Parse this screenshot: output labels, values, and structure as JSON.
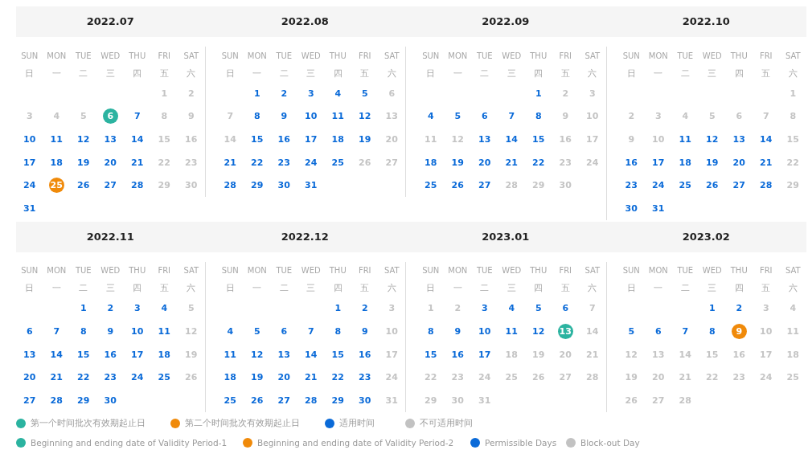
{
  "months": [
    {
      "title": "2022.07",
      "weekdays_en": [
        "SUN",
        "MON",
        "TUE",
        "WED",
        "THU",
        "FRI",
        "SAT"
      ],
      "weekdays_zh": [
        "日",
        "一",
        "二",
        "三",
        "四",
        "五",
        "六"
      ],
      "days": [
        {
          "kind": "blank"
        },
        {
          "kind": "blank"
        },
        {
          "kind": "blank"
        },
        {
          "kind": "blank"
        },
        {
          "kind": "blank"
        },
        {
          "d": "1",
          "kind": "off"
        },
        {
          "d": "2",
          "kind": "off"
        },
        {
          "d": "3",
          "kind": "off"
        },
        {
          "d": "4",
          "kind": "off"
        },
        {
          "d": "5",
          "kind": "off"
        },
        {
          "d": "6",
          "kind": "period1"
        },
        {
          "d": "7",
          "kind": "on"
        },
        {
          "d": "8",
          "kind": "off"
        },
        {
          "d": "9",
          "kind": "off"
        },
        {
          "d": "10",
          "kind": "on"
        },
        {
          "d": "11",
          "kind": "on"
        },
        {
          "d": "12",
          "kind": "on"
        },
        {
          "d": "13",
          "kind": "on"
        },
        {
          "d": "14",
          "kind": "on"
        },
        {
          "d": "15",
          "kind": "off"
        },
        {
          "d": "16",
          "kind": "off"
        },
        {
          "d": "17",
          "kind": "on"
        },
        {
          "d": "18",
          "kind": "on"
        },
        {
          "d": "19",
          "kind": "on"
        },
        {
          "d": "20",
          "kind": "on"
        },
        {
          "d": "21",
          "kind": "on"
        },
        {
          "d": "22",
          "kind": "off"
        },
        {
          "d": "23",
          "kind": "off"
        },
        {
          "d": "24",
          "kind": "on"
        },
        {
          "d": "25",
          "kind": "period2"
        },
        {
          "d": "26",
          "kind": "on"
        },
        {
          "d": "27",
          "kind": "on"
        },
        {
          "d": "28",
          "kind": "on"
        },
        {
          "d": "29",
          "kind": "off"
        },
        {
          "d": "30",
          "kind": "off"
        },
        {
          "d": "31",
          "kind": "on"
        }
      ]
    },
    {
      "title": "2022.08",
      "weekdays_en": [
        "SUN",
        "MON",
        "TUE",
        "WED",
        "THU",
        "FRI",
        "SAT"
      ],
      "weekdays_zh": [
        "日",
        "一",
        "二",
        "三",
        "四",
        "五",
        "六"
      ],
      "days": [
        {
          "kind": "blank"
        },
        {
          "d": "1",
          "kind": "on"
        },
        {
          "d": "2",
          "kind": "on"
        },
        {
          "d": "3",
          "kind": "on"
        },
        {
          "d": "4",
          "kind": "on"
        },
        {
          "d": "5",
          "kind": "on"
        },
        {
          "d": "6",
          "kind": "off"
        },
        {
          "d": "7",
          "kind": "off"
        },
        {
          "d": "8",
          "kind": "on"
        },
        {
          "d": "9",
          "kind": "on"
        },
        {
          "d": "10",
          "kind": "on"
        },
        {
          "d": "11",
          "kind": "on"
        },
        {
          "d": "12",
          "kind": "on"
        },
        {
          "d": "13",
          "kind": "off"
        },
        {
          "d": "14",
          "kind": "off"
        },
        {
          "d": "15",
          "kind": "on"
        },
        {
          "d": "16",
          "kind": "on"
        },
        {
          "d": "17",
          "kind": "on"
        },
        {
          "d": "18",
          "kind": "on"
        },
        {
          "d": "19",
          "kind": "on"
        },
        {
          "d": "20",
          "kind": "off"
        },
        {
          "d": "21",
          "kind": "on"
        },
        {
          "d": "22",
          "kind": "on"
        },
        {
          "d": "23",
          "kind": "on"
        },
        {
          "d": "24",
          "kind": "on"
        },
        {
          "d": "25",
          "kind": "on"
        },
        {
          "d": "26",
          "kind": "off"
        },
        {
          "d": "27",
          "kind": "off"
        },
        {
          "d": "28",
          "kind": "on"
        },
        {
          "d": "29",
          "kind": "on"
        },
        {
          "d": "30",
          "kind": "on"
        },
        {
          "d": "31",
          "kind": "on"
        }
      ]
    },
    {
      "title": "2022.09",
      "weekdays_en": [
        "SUN",
        "MON",
        "TUE",
        "WED",
        "THU",
        "FRI",
        "SAT"
      ],
      "weekdays_zh": [
        "日",
        "一",
        "二",
        "三",
        "四",
        "五",
        "六"
      ],
      "days": [
        {
          "kind": "blank"
        },
        {
          "kind": "blank"
        },
        {
          "kind": "blank"
        },
        {
          "kind": "blank"
        },
        {
          "d": "1",
          "kind": "on"
        },
        {
          "d": "2",
          "kind": "off"
        },
        {
          "d": "3",
          "kind": "off"
        },
        {
          "d": "4",
          "kind": "on"
        },
        {
          "d": "5",
          "kind": "on"
        },
        {
          "d": "6",
          "kind": "on"
        },
        {
          "d": "7",
          "kind": "on"
        },
        {
          "d": "8",
          "kind": "on"
        },
        {
          "d": "9",
          "kind": "off"
        },
        {
          "d": "10",
          "kind": "off"
        },
        {
          "d": "11",
          "kind": "off"
        },
        {
          "d": "12",
          "kind": "off"
        },
        {
          "d": "13",
          "kind": "on"
        },
        {
          "d": "14",
          "kind": "on"
        },
        {
          "d": "15",
          "kind": "on"
        },
        {
          "d": "16",
          "kind": "off"
        },
        {
          "d": "17",
          "kind": "off"
        },
        {
          "d": "18",
          "kind": "on"
        },
        {
          "d": "19",
          "kind": "on"
        },
        {
          "d": "20",
          "kind": "on"
        },
        {
          "d": "21",
          "kind": "on"
        },
        {
          "d": "22",
          "kind": "on"
        },
        {
          "d": "23",
          "kind": "off"
        },
        {
          "d": "24",
          "kind": "off"
        },
        {
          "d": "25",
          "kind": "on"
        },
        {
          "d": "26",
          "kind": "on"
        },
        {
          "d": "27",
          "kind": "on"
        },
        {
          "d": "28",
          "kind": "off"
        },
        {
          "d": "29",
          "kind": "off"
        },
        {
          "d": "30",
          "kind": "off"
        }
      ]
    },
    {
      "title": "2022.10",
      "weekdays_en": [
        "SUN",
        "MON",
        "TUE",
        "WED",
        "THU",
        "FRI",
        "SAT"
      ],
      "weekdays_zh": [
        "日",
        "一",
        "二",
        "三",
        "四",
        "五",
        "六"
      ],
      "days": [
        {
          "kind": "blank"
        },
        {
          "kind": "blank"
        },
        {
          "kind": "blank"
        },
        {
          "kind": "blank"
        },
        {
          "kind": "blank"
        },
        {
          "kind": "blank"
        },
        {
          "d": "1",
          "kind": "off"
        },
        {
          "d": "2",
          "kind": "off"
        },
        {
          "d": "3",
          "kind": "off"
        },
        {
          "d": "4",
          "kind": "off"
        },
        {
          "d": "5",
          "kind": "off"
        },
        {
          "d": "6",
          "kind": "off"
        },
        {
          "d": "7",
          "kind": "off"
        },
        {
          "d": "8",
          "kind": "off"
        },
        {
          "d": "9",
          "kind": "off"
        },
        {
          "d": "10",
          "kind": "off"
        },
        {
          "d": "11",
          "kind": "on"
        },
        {
          "d": "12",
          "kind": "on"
        },
        {
          "d": "13",
          "kind": "on"
        },
        {
          "d": "14",
          "kind": "on"
        },
        {
          "d": "15",
          "kind": "off"
        },
        {
          "d": "16",
          "kind": "on"
        },
        {
          "d": "17",
          "kind": "on"
        },
        {
          "d": "18",
          "kind": "on"
        },
        {
          "d": "19",
          "kind": "on"
        },
        {
          "d": "20",
          "kind": "on"
        },
        {
          "d": "21",
          "kind": "on"
        },
        {
          "d": "22",
          "kind": "off"
        },
        {
          "d": "23",
          "kind": "on"
        },
        {
          "d": "24",
          "kind": "on"
        },
        {
          "d": "25",
          "kind": "on"
        },
        {
          "d": "26",
          "kind": "on"
        },
        {
          "d": "27",
          "kind": "on"
        },
        {
          "d": "28",
          "kind": "on"
        },
        {
          "d": "29",
          "kind": "off"
        },
        {
          "d": "30",
          "kind": "on"
        },
        {
          "d": "31",
          "kind": "on"
        }
      ]
    },
    {
      "title": "2022.11",
      "weekdays_en": [
        "SUN",
        "MON",
        "TUE",
        "WED",
        "THU",
        "FRI",
        "SAT"
      ],
      "weekdays_zh": [
        "日",
        "一",
        "二",
        "三",
        "四",
        "五",
        "六"
      ],
      "days": [
        {
          "kind": "blank"
        },
        {
          "kind": "blank"
        },
        {
          "d": "1",
          "kind": "on"
        },
        {
          "d": "2",
          "kind": "on"
        },
        {
          "d": "3",
          "kind": "on"
        },
        {
          "d": "4",
          "kind": "on"
        },
        {
          "d": "5",
          "kind": "off"
        },
        {
          "d": "6",
          "kind": "on"
        },
        {
          "d": "7",
          "kind": "on"
        },
        {
          "d": "8",
          "kind": "on"
        },
        {
          "d": "9",
          "kind": "on"
        },
        {
          "d": "10",
          "kind": "on"
        },
        {
          "d": "11",
          "kind": "on"
        },
        {
          "d": "12",
          "kind": "off"
        },
        {
          "d": "13",
          "kind": "on"
        },
        {
          "d": "14",
          "kind": "on"
        },
        {
          "d": "15",
          "kind": "on"
        },
        {
          "d": "16",
          "kind": "on"
        },
        {
          "d": "17",
          "kind": "on"
        },
        {
          "d": "18",
          "kind": "on"
        },
        {
          "d": "19",
          "kind": "off"
        },
        {
          "d": "20",
          "kind": "on"
        },
        {
          "d": "21",
          "kind": "on"
        },
        {
          "d": "22",
          "kind": "on"
        },
        {
          "d": "23",
          "kind": "on"
        },
        {
          "d": "24",
          "kind": "on"
        },
        {
          "d": "25",
          "kind": "on"
        },
        {
          "d": "26",
          "kind": "off"
        },
        {
          "d": "27",
          "kind": "on"
        },
        {
          "d": "28",
          "kind": "on"
        },
        {
          "d": "29",
          "kind": "on"
        },
        {
          "d": "30",
          "kind": "on"
        }
      ]
    },
    {
      "title": "2022.12",
      "weekdays_en": [
        "SUN",
        "MON",
        "TUE",
        "WED",
        "THU",
        "FRI",
        "SAT"
      ],
      "weekdays_zh": [
        "日",
        "一",
        "二",
        "三",
        "四",
        "五",
        "六"
      ],
      "days": [
        {
          "kind": "blank"
        },
        {
          "kind": "blank"
        },
        {
          "kind": "blank"
        },
        {
          "kind": "blank"
        },
        {
          "d": "1",
          "kind": "on"
        },
        {
          "d": "2",
          "kind": "on"
        },
        {
          "d": "3",
          "kind": "off"
        },
        {
          "d": "4",
          "kind": "on"
        },
        {
          "d": "5",
          "kind": "on"
        },
        {
          "d": "6",
          "kind": "on"
        },
        {
          "d": "7",
          "kind": "on"
        },
        {
          "d": "8",
          "kind": "on"
        },
        {
          "d": "9",
          "kind": "on"
        },
        {
          "d": "10",
          "kind": "off"
        },
        {
          "d": "11",
          "kind": "on"
        },
        {
          "d": "12",
          "kind": "on"
        },
        {
          "d": "13",
          "kind": "on"
        },
        {
          "d": "14",
          "kind": "on"
        },
        {
          "d": "15",
          "kind": "on"
        },
        {
          "d": "16",
          "kind": "on"
        },
        {
          "d": "17",
          "kind": "off"
        },
        {
          "d": "18",
          "kind": "on"
        },
        {
          "d": "19",
          "kind": "on"
        },
        {
          "d": "20",
          "kind": "on"
        },
        {
          "d": "21",
          "kind": "on"
        },
        {
          "d": "22",
          "kind": "on"
        },
        {
          "d": "23",
          "kind": "on"
        },
        {
          "d": "24",
          "kind": "off"
        },
        {
          "d": "25",
          "kind": "on"
        },
        {
          "d": "26",
          "kind": "on"
        },
        {
          "d": "27",
          "kind": "on"
        },
        {
          "d": "28",
          "kind": "on"
        },
        {
          "d": "29",
          "kind": "on"
        },
        {
          "d": "30",
          "kind": "on"
        },
        {
          "d": "31",
          "kind": "off"
        }
      ]
    },
    {
      "title": "2023.01",
      "weekdays_en": [
        "SUN",
        "MON",
        "TUE",
        "WED",
        "THU",
        "FRI",
        "SAT"
      ],
      "weekdays_zh": [
        "日",
        "一",
        "二",
        "三",
        "四",
        "五",
        "六"
      ],
      "days": [
        {
          "d": "1",
          "kind": "off"
        },
        {
          "d": "2",
          "kind": "off"
        },
        {
          "d": "3",
          "kind": "on"
        },
        {
          "d": "4",
          "kind": "on"
        },
        {
          "d": "5",
          "kind": "on"
        },
        {
          "d": "6",
          "kind": "on"
        },
        {
          "d": "7",
          "kind": "off"
        },
        {
          "d": "8",
          "kind": "on"
        },
        {
          "d": "9",
          "kind": "on"
        },
        {
          "d": "10",
          "kind": "on"
        },
        {
          "d": "11",
          "kind": "on"
        },
        {
          "d": "12",
          "kind": "on"
        },
        {
          "d": "13",
          "kind": "period1"
        },
        {
          "d": "14",
          "kind": "off"
        },
        {
          "d": "15",
          "kind": "on"
        },
        {
          "d": "16",
          "kind": "on"
        },
        {
          "d": "17",
          "kind": "on"
        },
        {
          "d": "18",
          "kind": "off"
        },
        {
          "d": "19",
          "kind": "off"
        },
        {
          "d": "20",
          "kind": "off"
        },
        {
          "d": "21",
          "kind": "off"
        },
        {
          "d": "22",
          "kind": "off"
        },
        {
          "d": "23",
          "kind": "off"
        },
        {
          "d": "24",
          "kind": "off"
        },
        {
          "d": "25",
          "kind": "off"
        },
        {
          "d": "26",
          "kind": "off"
        },
        {
          "d": "27",
          "kind": "off"
        },
        {
          "d": "28",
          "kind": "off"
        },
        {
          "d": "29",
          "kind": "off"
        },
        {
          "d": "30",
          "kind": "off"
        },
        {
          "d": "31",
          "kind": "off"
        }
      ]
    },
    {
      "title": "2023.02",
      "weekdays_en": [
        "SUN",
        "MON",
        "TUE",
        "WED",
        "THU",
        "FRI",
        "SAT"
      ],
      "weekdays_zh": [
        "日",
        "一",
        "二",
        "三",
        "四",
        "五",
        "六"
      ],
      "days": [
        {
          "kind": "blank"
        },
        {
          "kind": "blank"
        },
        {
          "kind": "blank"
        },
        {
          "d": "1",
          "kind": "on"
        },
        {
          "d": "2",
          "kind": "on"
        },
        {
          "d": "3",
          "kind": "off"
        },
        {
          "d": "4",
          "kind": "off"
        },
        {
          "d": "5",
          "kind": "on"
        },
        {
          "d": "6",
          "kind": "on"
        },
        {
          "d": "7",
          "kind": "on"
        },
        {
          "d": "8",
          "kind": "on"
        },
        {
          "d": "9",
          "kind": "period2"
        },
        {
          "d": "10",
          "kind": "off"
        },
        {
          "d": "11",
          "kind": "off"
        },
        {
          "d": "12",
          "kind": "off"
        },
        {
          "d": "13",
          "kind": "off"
        },
        {
          "d": "14",
          "kind": "off"
        },
        {
          "d": "15",
          "kind": "off"
        },
        {
          "d": "16",
          "kind": "off"
        },
        {
          "d": "17",
          "kind": "off"
        },
        {
          "d": "18",
          "kind": "off"
        },
        {
          "d": "19",
          "kind": "off"
        },
        {
          "d": "20",
          "kind": "off"
        },
        {
          "d": "21",
          "kind": "off"
        },
        {
          "d": "22",
          "kind": "off"
        },
        {
          "d": "23",
          "kind": "off"
        },
        {
          "d": "24",
          "kind": "off"
        },
        {
          "d": "25",
          "kind": "off"
        },
        {
          "d": "26",
          "kind": "off"
        },
        {
          "d": "27",
          "kind": "off"
        },
        {
          "d": "28",
          "kind": "off"
        }
      ]
    }
  ],
  "legend": [
    [
      {
        "label": "第一个时间批次有效期起止日",
        "color": "#2bb3a0"
      },
      {
        "label": "第二个时间批次有效期起止日",
        "color": "#f08a0a"
      },
      {
        "label": "适用时间",
        "color": "#0a6ad8"
      },
      {
        "label": "不可适用时间",
        "color": "#c2c2c2"
      }
    ],
    [
      {
        "label": "Beginning and ending date of Validity Period-1",
        "color": "#2bb3a0"
      },
      {
        "label": "Beginning and ending date of Validity Period-2",
        "color": "#f08a0a"
      },
      {
        "label": "Permissible Days",
        "color": "#0a6ad8"
      },
      {
        "label": "Block-out Day",
        "color": "#c2c2c2"
      }
    ]
  ]
}
